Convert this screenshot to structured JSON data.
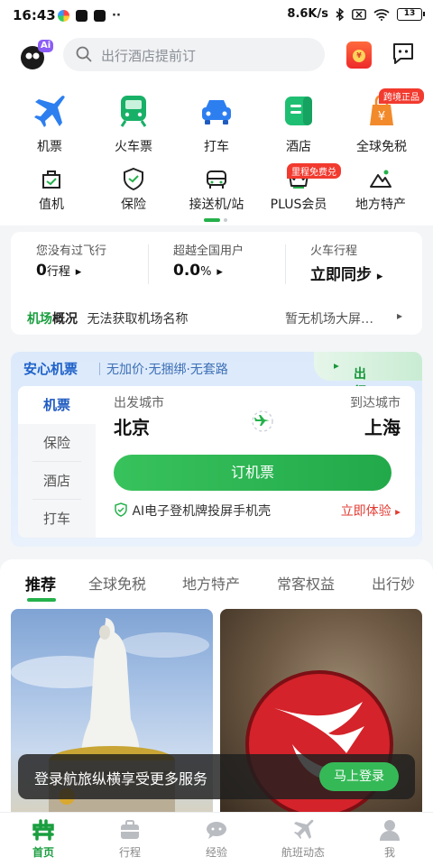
{
  "status": {
    "time": "16:43",
    "network_speed": "8.6K/s",
    "battery": "13"
  },
  "search": {
    "placeholder": "出行酒店提前订"
  },
  "logo": {
    "badge": "Ai"
  },
  "main_entries": [
    {
      "label": "机票",
      "icon": "airplane-icon"
    },
    {
      "label": "火车票",
      "icon": "train-icon"
    },
    {
      "label": "打车",
      "icon": "car-icon"
    },
    {
      "label": "酒店",
      "icon": "hotel-icon"
    },
    {
      "label": "全球免税",
      "icon": "dutyfree-icon",
      "tag": "跨境正品"
    }
  ],
  "sub_entries": [
    {
      "label": "值机",
      "icon": "checkin-icon"
    },
    {
      "label": "保险",
      "icon": "shield-icon"
    },
    {
      "label": "接送机/站",
      "icon": "shuttle-icon"
    },
    {
      "label": "PLUS会员",
      "icon": "crown-icon",
      "tag": "里程免费兑"
    },
    {
      "label": "地方特产",
      "icon": "mountain-icon"
    }
  ],
  "info": {
    "col1_title": "您没有过飞行",
    "col1_value": "0",
    "col1_unit": "行程",
    "col2_title": "超越全国用户",
    "col2_value": "0.0",
    "col2_unit": "%",
    "col3_title": "火车行程",
    "col3_value": "立即同步",
    "airport_brand_a": "机场",
    "airport_brand_b": "概况",
    "airport_text": "无法获取机场名称",
    "airport_right": "暂无机场大屏…"
  },
  "flight_card": {
    "title": "安心机票",
    "subtitle": "无加价·无捆绑·无套路",
    "tool": "出行工具",
    "tabs": [
      "机票",
      "保险",
      "酒店",
      "打车"
    ],
    "depart_label": "出发城市",
    "depart_city": "北京",
    "arrive_label": "到达城市",
    "arrive_city": "上海",
    "book_button": "订机票",
    "ai_text": "AI电子登机牌投屏手机壳",
    "ai_try": "立即体验"
  },
  "rec_tabs": [
    "推荐",
    "全球免税",
    "地方特产",
    "常客权益",
    "出行妙"
  ],
  "login_banner": {
    "text": "登录航旅纵横享受更多服务",
    "button": "马上登录"
  },
  "bottom_nav": [
    {
      "label": "首页",
      "icon": "home-icon"
    },
    {
      "label": "行程",
      "icon": "suitcase-icon"
    },
    {
      "label": "经验",
      "icon": "chat-bubble-icon"
    },
    {
      "label": "航班动态",
      "icon": "flight-status-icon"
    },
    {
      "label": "我",
      "icon": "user-icon"
    }
  ],
  "colors": {
    "brand_green": "#25b14b",
    "flight_blue": "#1f62c9",
    "red": "#f23a2f"
  }
}
